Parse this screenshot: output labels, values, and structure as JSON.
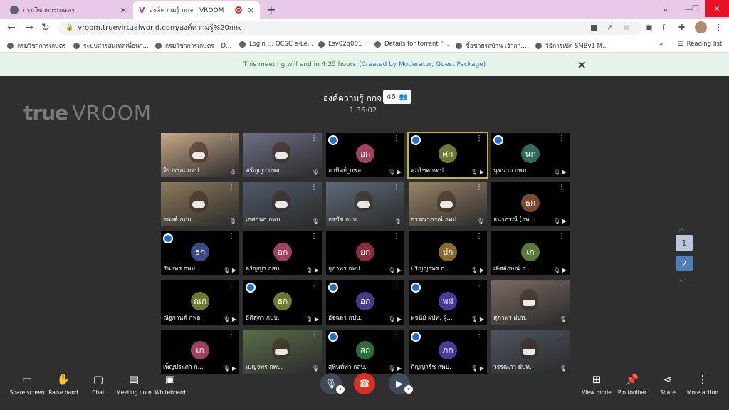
{
  "browser": {
    "tabs": [
      {
        "title": "กรมวิชาการเกษตร"
      },
      {
        "title": "องค์ความรู้ กกจ | VROOM"
      }
    ],
    "url": "vroom.truevirtualworld.com/องค์ความรู้%20กกจ",
    "bookmarks": [
      "กรมวิชาการเกษตร",
      "ระบบสารสนเทศเพื่อนา...",
      "กรมวิชาการเกษตร – D...",
      "Login ::: OCSC e-Le...",
      "Esv02q001 ::",
      "Details for torrent \"...",
      "ซื้อขายรถบ้าน เจ้ากา...",
      "วิธีการเปิด SMBv1 M..."
    ],
    "reading_list": "Reading list"
  },
  "notice": {
    "text": "This meeting will end in 4:25 hours",
    "link": "(Created by Moderator, Guest Package)"
  },
  "meeting": {
    "brand_main": "true",
    "brand_sub": "VROOM",
    "title": "องค์ความรู้ กกจ",
    "timer": "1:36:02",
    "participant_count": "46"
  },
  "tiles": [
    {
      "name": "จิรวรรณ กทป.",
      "initials": "",
      "video": true,
      "bg": "#c9a98a",
      "avatar": "",
      "speaking": false,
      "cam_badge": false
    },
    {
      "name": "ศรัญญา กพอ.",
      "initials": "",
      "video": true,
      "bg": "#6d6f86",
      "avatar": "",
      "speaking": false,
      "cam_badge": false
    },
    {
      "name": "อาทิตย์_กพอ",
      "initials": "อก",
      "video": false,
      "bg": "#000000",
      "avatar": "#a0425f",
      "speaking": false,
      "cam_badge": true
    },
    {
      "name": "ศุภโชค กทป.",
      "initials": "ศก",
      "video": false,
      "bg": "#000000",
      "avatar": "#6b7a2e",
      "speaking": true,
      "cam_badge": true
    },
    {
      "name": "นุชนาถ กพบ",
      "initials": "นก",
      "video": false,
      "bg": "#000000",
      "avatar": "#2e6b5a",
      "speaking": false,
      "cam_badge": true
    },
    {
      "name": "อนงค์ กปบ.",
      "initials": "",
      "video": true,
      "bg": "#8c7a5c",
      "avatar": "",
      "speaking": false,
      "cam_badge": false
    },
    {
      "name": "เกศกนก กพบ",
      "initials": "",
      "video": true,
      "bg": "#4e5a66",
      "avatar": "",
      "speaking": false,
      "cam_badge": false
    },
    {
      "name": "กรชัช กปบ.",
      "initials": "",
      "video": true,
      "bg": "#5e6a78",
      "avatar": "",
      "speaking": false,
      "cam_badge": false
    },
    {
      "name": "กรรณาภรณ์ กทป.",
      "initials": "",
      "video": true,
      "bg": "#9a8468",
      "avatar": "",
      "speaking": false,
      "cam_badge": false
    },
    {
      "name": "ธนาภรณ์ (กพ...",
      "initials": "ธก",
      "video": false,
      "bg": "#000000",
      "avatar": "#7a4a2e",
      "speaking": false,
      "cam_badge": false
    },
    {
      "name": "ธันยพร กพบ.",
      "initials": "ธก",
      "video": false,
      "bg": "#000000",
      "avatar": "#3a4a8a",
      "speaking": false,
      "cam_badge": true
    },
    {
      "name": "อรัญญา กสบ.",
      "initials": "อก",
      "video": false,
      "bg": "#000000",
      "avatar": "#a0425f",
      "speaking": false,
      "cam_badge": false
    },
    {
      "name": "ยุภาพร กทป.",
      "initials": "ยก",
      "video": false,
      "bg": "#000000",
      "avatar": "#8a2e3e",
      "speaking": false,
      "cam_badge": false
    },
    {
      "name": "ปริญญาพร ก...",
      "initials": "ปก",
      "video": false,
      "bg": "#000000",
      "avatar": "#8a6a2e",
      "speaking": false,
      "cam_badge": false
    },
    {
      "name": "เลิศลักษณ์ ก...",
      "initials": "เก",
      "video": false,
      "bg": "#000000",
      "avatar": "#5a7a3a",
      "speaking": false,
      "cam_badge": false
    },
    {
      "name": "ณัฐกานต์ กพอ.",
      "initials": "ณก",
      "video": false,
      "bg": "#000000",
      "avatar": "#6b7a2e",
      "speaking": false,
      "cam_badge": false
    },
    {
      "name": "ธิติสุดา กปบ.",
      "initials": "ธก",
      "video": false,
      "bg": "#000000",
      "avatar": "#6b7a2e",
      "speaking": false,
      "cam_badge": true
    },
    {
      "name": "อัจฉลา กปบ.",
      "initials": "อก",
      "video": false,
      "bg": "#000000",
      "avatar": "#4a3a8a",
      "speaking": false,
      "cam_badge": true
    },
    {
      "name": "พจนีย์ ฝปท. ผู้...",
      "initials": "พฝ",
      "video": false,
      "bg": "#000000",
      "avatar": "#4a3aa0",
      "speaking": false,
      "cam_badge": true
    },
    {
      "name": "สุภาพร ฝปท.",
      "initials": "",
      "video": true,
      "bg": "#7a6a62",
      "avatar": "",
      "speaking": false,
      "cam_badge": false
    },
    {
      "name": "เพ็ญประภา ก...",
      "initials": "เก",
      "video": false,
      "bg": "#000000",
      "avatar": "#a0425f",
      "speaking": false,
      "cam_badge": false
    },
    {
      "name": "เบญจพร กพบ.",
      "initials": "",
      "video": true,
      "bg": "#5a6e4a",
      "avatar": "",
      "speaking": false,
      "cam_badge": false
    },
    {
      "name": "สุพินท์ทา กสบ.",
      "initials": "สก",
      "video": false,
      "bg": "#000000",
      "avatar": "#2e6b3a",
      "speaking": false,
      "cam_badge": true
    },
    {
      "name": "ภิญญารัช กพบ.",
      "initials": "ภก",
      "video": false,
      "bg": "#000000",
      "avatar": "#4a3aa0",
      "speaking": false,
      "cam_badge": true
    },
    {
      "name": "วรรณภา ฝปท.",
      "initials": "",
      "video": true,
      "bg": "#4e5560",
      "avatar": "",
      "speaking": false,
      "cam_badge": false
    }
  ],
  "pager": {
    "page1": "1",
    "page2": "2"
  },
  "controls": {
    "share_screen": "Share screen",
    "raise_hand": "Raise hand",
    "chat": "Chat",
    "meeting_note": "Meeting note",
    "whiteboard": "Whiteboard",
    "view_mode": "View mode",
    "pin_toolbar": "Pin toolbar",
    "share": "Share",
    "more_action": "More action"
  }
}
